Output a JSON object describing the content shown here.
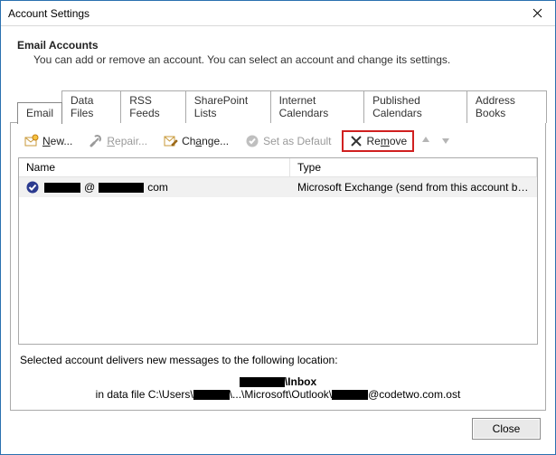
{
  "window": {
    "title": "Account Settings"
  },
  "intro": {
    "heading": "Email Accounts",
    "subtext": "You can add or remove an account. You can select an account and change its settings."
  },
  "tabs": [
    {
      "label": "Email",
      "active": true
    },
    {
      "label": "Data Files",
      "active": false
    },
    {
      "label": "RSS Feeds",
      "active": false
    },
    {
      "label": "SharePoint Lists",
      "active": false
    },
    {
      "label": "Internet Calendars",
      "active": false
    },
    {
      "label": "Published Calendars",
      "active": false
    },
    {
      "label": "Address Books",
      "active": false
    }
  ],
  "toolbar": {
    "new_label": "New...",
    "repair_label": "Repair...",
    "change_label": "Change...",
    "set_default_label": "Set as Default",
    "remove_label": "Remove"
  },
  "list": {
    "columns": {
      "name": "Name",
      "type": "Type"
    },
    "rows": [
      {
        "name_left": "@",
        "name_right": "com",
        "type": "Microsoft Exchange (send from this account by def...",
        "is_default": true
      }
    ]
  },
  "info": {
    "line1": "Selected account delivers new messages to the following location:",
    "folder": "\\Inbox",
    "path_prefix": "in data file C:\\Users\\",
    "path_mid": "\\...\\Microsoft\\Outlook\\",
    "path_suffix": "@codetwo.com.ost"
  },
  "footer": {
    "close_label": "Close"
  }
}
